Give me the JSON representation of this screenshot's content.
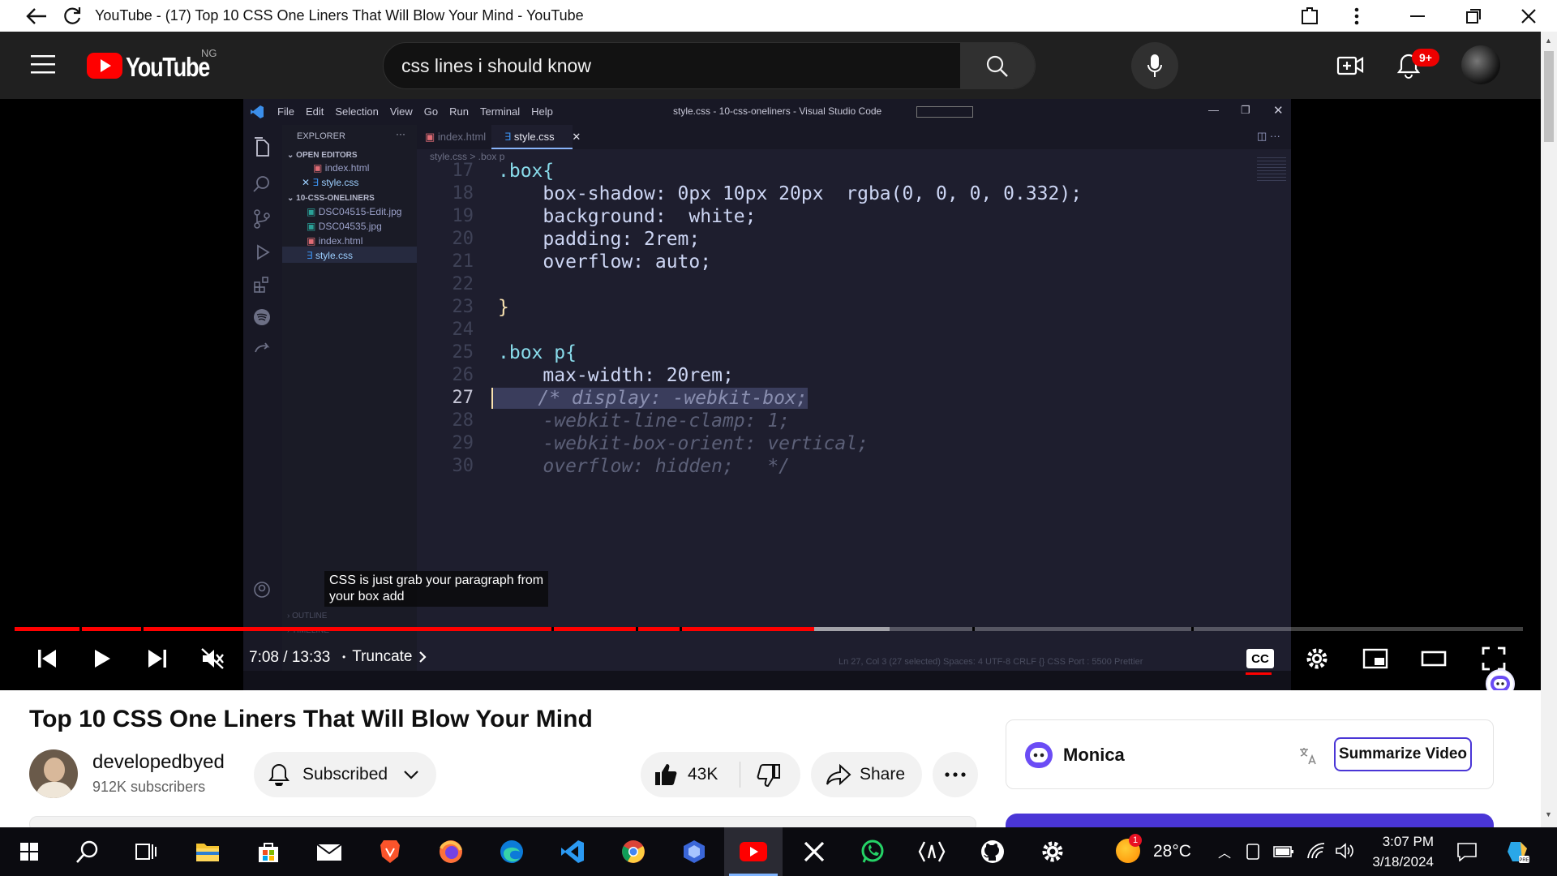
{
  "window": {
    "title": "YouTube - (17) Top 10 CSS One Liners That Will Blow Your Mind - YouTube"
  },
  "header": {
    "logo_text": "YouTube",
    "region": "NG",
    "search_value": "css lines i should know",
    "notifications_badge": "9+"
  },
  "vscode": {
    "menu": [
      "File",
      "Edit",
      "Selection",
      "View",
      "Go",
      "Run",
      "Terminal",
      "Help"
    ],
    "window_title": "style.css - 10-css-oneliners - Visual Studio Code",
    "explorer_label": "EXPLORER",
    "open_editors_label": "OPEN EDITORS",
    "open_editors": [
      "index.html",
      "style.css"
    ],
    "folder_label": "10-CSS-ONELINERS",
    "files": [
      "DSC04515-Edit.jpg",
      "DSC04535.jpg",
      "index.html",
      "style.css"
    ],
    "tabs": [
      "index.html",
      "style.css"
    ],
    "breadcrumb": "style.css > .box p",
    "outline_label": "OUTLINE",
    "timeline_label": "TIMELINE",
    "status_text": "Ln 27, Col 3 (27 selected)   Spaces: 4   UTF-8   CRLF   {} CSS   Port : 5500   Prettier",
    "code_lines": [
      {
        "num": "17",
        "text": ".box{"
      },
      {
        "num": "18",
        "text": "    box-shadow: 0px 10px 20px  rgba(0, 0, 0, 0.332);"
      },
      {
        "num": "19",
        "text": "    background:  white;"
      },
      {
        "num": "20",
        "text": "    padding: 2rem;"
      },
      {
        "num": "21",
        "text": "    overflow: auto;"
      },
      {
        "num": "22",
        "text": ""
      },
      {
        "num": "23",
        "text": "}"
      },
      {
        "num": "24",
        "text": ""
      },
      {
        "num": "25",
        "text": ".box p{"
      },
      {
        "num": "26",
        "text": "    max-width: 20rem;"
      },
      {
        "num": "27",
        "text": "    /* display: -webkit-box;"
      },
      {
        "num": "28",
        "text": "    -webkit-line-clamp: 1;"
      },
      {
        "num": "29",
        "text": "    -webkit-box-orient: vertical;"
      },
      {
        "num": "30",
        "text": "    overflow: hidden;   */"
      }
    ]
  },
  "player": {
    "caption_line1": "CSS is just grab your paragraph from",
    "caption_line2": "your box add",
    "time": "7:08 / 13:33",
    "chapter": "Truncate",
    "progress_fraction": 0.53,
    "buffered_fraction": 0.58,
    "cc_label": "CC"
  },
  "video": {
    "title": "Top 10 CSS One Liners That Will Blow Your Mind",
    "channel": "developedbyed",
    "subscribers": "912K subscribers",
    "subscribed_label": "Subscribed",
    "likes": "43K",
    "share_label": "Share"
  },
  "monica": {
    "name": "Monica",
    "summarize_label": "Summarize Video"
  },
  "taskbar": {
    "weather": "28°C",
    "weather_badge": "1",
    "time": "3:07 PM",
    "date": "3/18/2024"
  },
  "colors": {
    "youtube_red": "#ff0000",
    "monica_purple": "#4a36d6",
    "header_bg": "#202020"
  }
}
